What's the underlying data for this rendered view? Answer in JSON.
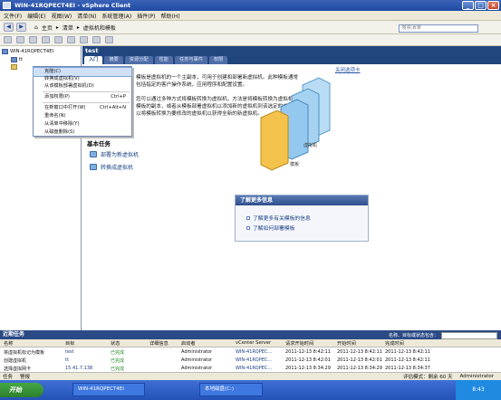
{
  "window": {
    "title": "WIN-41RQPECT4EI - vSphere Client"
  },
  "menu": [
    "文件(F)",
    "编辑(E)",
    "视图(W)",
    "清单(N)",
    "系统管理(A)",
    "插件(P)",
    "帮助(H)"
  ],
  "breadcrumb": [
    "主页",
    "清单",
    "虚拟机和模板"
  ],
  "search": {
    "placeholder": "搜索清单"
  },
  "tree": {
    "root": "WIN-41RQPECT4EI",
    "child": "tt",
    "grandchild": "转换成虚拟机"
  },
  "object_title": "test",
  "tabs": [
    "入门",
    "摘要",
    "资源分配",
    "性能",
    "任务与事件",
    "权限"
  ],
  "close_tab": "关闭选项卡",
  "description": [
    "模板是虚拟机的一个主副本，可用于创建和部署新虚拟机。此种模板通常",
    "包括指定的客户操作系统，应用程序和配置设置。",
    "",
    "您可以通过多种方式将模板转换为虚拟机。方法是将模板转换为虚拟机，创建",
    "模板的副本，或者从模板部署虚拟机以添加新的虚拟机到该选定的文件夹。您可",
    "以将模板转换为要修改的虚拟机以获得全新的新虚拟机。"
  ],
  "graphic": {
    "label_vm": "虚拟机",
    "label_template": "模板"
  },
  "basic_tasks": {
    "title": "基本任务",
    "items": [
      "部署为新虚拟机",
      "转换成虚拟机"
    ]
  },
  "learn_more": {
    "title": "了解更多信息",
    "links": [
      "了解更多有关模板的信息",
      "了解如何部署模板"
    ]
  },
  "context_menu": [
    {
      "label": "克隆(C)",
      "shortcut": "",
      "selected": true
    },
    {
      "label": "转换成虚拟机(V)",
      "shortcut": ""
    },
    {
      "label": "从该模板部署虚拟机(D)",
      "shortcut": ""
    },
    {
      "sep": true
    },
    {
      "label": "添加权限(P)",
      "shortcut": "Ctrl+P"
    },
    {
      "sep": true
    },
    {
      "label": "在新窗口中打开(W)",
      "shortcut": "Ctrl+Alt+N"
    },
    {
      "label": "重命名(N)",
      "shortcut": ""
    },
    {
      "label": "从清单中移除(Y)",
      "shortcut": ""
    },
    {
      "label": "从磁盘删除(S)",
      "shortcut": ""
    }
  ],
  "recent_tasks": {
    "title": "近期任务",
    "filter_label": "名称、目标或状态包含：",
    "headers": [
      "名称",
      "目标",
      "状态",
      "详细信息",
      "启动者",
      "vCenter Server",
      "请求开始时间",
      "开始时间",
      "完成时间"
    ],
    "rows": [
      [
        "将虚拟机标记为模板",
        "test",
        "已完成",
        "",
        "Administrator",
        "WIN-41RQPEC...",
        "2011-12-13 8:42:11",
        "2011-12-13 8:42:11",
        "2011-12-13 8:42:11"
      ],
      [
        "创建虚拟机",
        "tt",
        "已完成",
        "",
        "Administrator",
        "WIN-41RQPEC...",
        "2011-12-13 8:42:01",
        "2011-12-13 8:42:01",
        "2011-12-13 8:42:11"
      ],
      [
        "选择虚拟网卡",
        "15.41.7.138",
        "已完成",
        "",
        "Administrator",
        "WIN-41RQPEC...",
        "2011-12-13 8:34:29",
        "2011-12-13 8:34:29",
        "2011-12-13 8:34:37"
      ]
    ]
  },
  "status_bar": {
    "tasks": "任务",
    "alarms": "警报",
    "license": "评估模式：剩余 60 天",
    "user": "Administrator"
  },
  "taskbar": {
    "start": "开始",
    "items": [
      "WIN-41RQPECT4EI",
      "本地磁盘(C:)"
    ],
    "clock": "8:43"
  },
  "colors": {
    "title_bar": "#2a55b0",
    "header": "#21457f",
    "accent": "#1b3f86",
    "ok": "#2a8a2a"
  }
}
